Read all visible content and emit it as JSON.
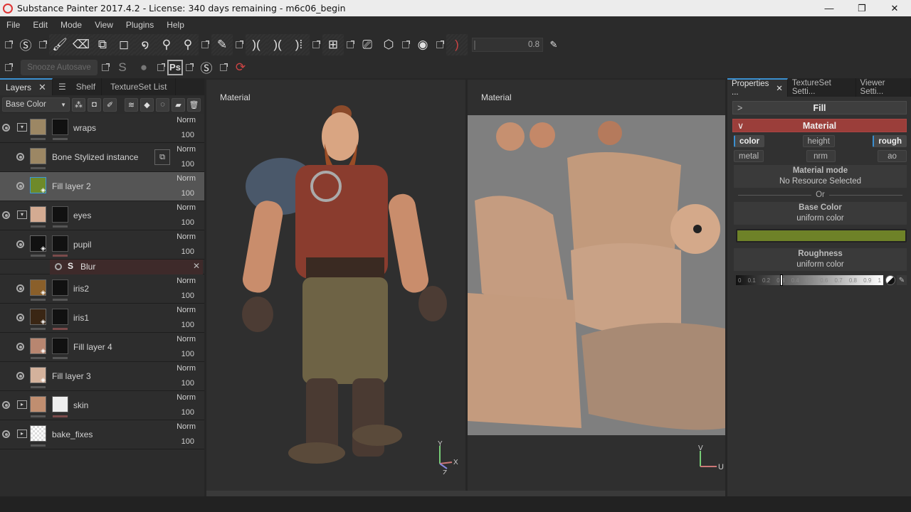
{
  "window": {
    "title": "Substance Painter 2017.4.2 - License: 340 days remaining - m6c06_begin",
    "controls": {
      "minimize": "—",
      "restore": "❐",
      "close": "✕"
    }
  },
  "menu": [
    "File",
    "Edit",
    "Mode",
    "View",
    "Plugins",
    "Help"
  ],
  "toolbar": {
    "tools": [
      "substance-logo-icon",
      "paint-brush-icon",
      "eraser-icon",
      "projection-icon",
      "polygon-fill-icon",
      "smudge-icon",
      "clone-stamp-icon",
      "material-picker-icon",
      "color-picker-icon",
      "symmetry-icon",
      "symmetry-x-icon",
      "symmetry-mirror-icon",
      "viewport-split-icon",
      "camera-icon",
      "cube-icon",
      "screenshot-icon",
      "brush-alignment-icon"
    ],
    "brush_value": "0.8",
    "snooze_label": "Snooze Autosave",
    "ps_label": "Ps"
  },
  "left_panel": {
    "tabs": [
      {
        "label": "Layers",
        "active": true
      },
      {
        "label": "Shelf",
        "active": false
      },
      {
        "label": "TextureSet List",
        "active": false
      }
    ],
    "channel": "Base Color",
    "layers": [
      {
        "name": "wraps",
        "blend": "Norm",
        "opacity": "100",
        "type": "folder",
        "thumb": "#9c8764",
        "mask": true,
        "indent": false,
        "selected": false
      },
      {
        "name": "Bone Stylized instance",
        "blend": "Norm",
        "opacity": "100",
        "type": "instance",
        "thumb": "#9c8764",
        "mask": false,
        "indent": true,
        "selected": false
      },
      {
        "name": "Fill layer 2",
        "blend": "Norm",
        "opacity": "100",
        "type": "fill",
        "thumb": "#6e8a2a",
        "mask": false,
        "indent": true,
        "selected": true
      },
      {
        "name": "eyes",
        "blend": "Norm",
        "opacity": "100",
        "type": "folder",
        "thumb": "#d4ab92",
        "mask": true,
        "indent": false,
        "selected": false
      },
      {
        "name": "pupil",
        "blend": "Norm",
        "opacity": "100",
        "type": "fill",
        "thumb": "#111111",
        "mask": true,
        "indent": true,
        "selected": false
      },
      {
        "name": "iris2",
        "blend": "Norm",
        "opacity": "100",
        "type": "fill",
        "thumb": "#8a5f2a",
        "mask": true,
        "indent": true,
        "selected": false
      },
      {
        "name": "iris1",
        "blend": "Norm",
        "opacity": "100",
        "type": "fill",
        "thumb": "#3a2614",
        "mask": true,
        "indent": true,
        "selected": false
      },
      {
        "name": "Fill layer 4",
        "blend": "Norm",
        "opacity": "100",
        "type": "fill",
        "thumb": "#b88670",
        "mask": true,
        "indent": true,
        "selected": false
      },
      {
        "name": "Fill layer 3",
        "blend": "Norm",
        "opacity": "100",
        "type": "fill",
        "thumb": "#d4b29c",
        "mask": false,
        "indent": true,
        "selected": false
      },
      {
        "name": "skin",
        "blend": "Norm",
        "opacity": "100",
        "type": "folder-closed",
        "thumb": "#c08e70",
        "mask": true,
        "indent": false,
        "selected": false
      },
      {
        "name": "bake_fixes",
        "blend": "Norm",
        "opacity": "100",
        "type": "folder-closed",
        "thumb": "checker",
        "mask": false,
        "indent": false,
        "selected": false
      }
    ],
    "effect": {
      "name": "Blur",
      "after_layer": "pupil"
    }
  },
  "viewport3d": {
    "label": "Material",
    "axes": [
      "Y",
      "X",
      "Z"
    ]
  },
  "viewport2d": {
    "label": "Material",
    "axes": [
      "V",
      "U"
    ]
  },
  "right_panel": {
    "tabs": [
      {
        "label": "Properties ...",
        "active": true
      },
      {
        "label": "TextureSet Setti...",
        "active": false
      },
      {
        "label": "Viewer Setti...",
        "active": false
      }
    ],
    "fill_label": "Fill",
    "material_label": "Material",
    "channels": [
      {
        "label": "color",
        "on": true
      },
      {
        "label": "height",
        "on": false
      },
      {
        "label": "rough",
        "on": true
      },
      {
        "label": "metal",
        "on": false
      },
      {
        "label": "nrm",
        "on": false
      },
      {
        "label": "ao",
        "on": false
      }
    ],
    "material_mode": {
      "title": "Material mode",
      "value": "No Resource Selected"
    },
    "or_label": "Or",
    "base_color": {
      "title": "Base Color",
      "mode": "uniform color",
      "color": "#6e8228"
    },
    "roughness": {
      "title": "Roughness",
      "mode": "uniform color",
      "value": 0.3,
      "ticks": [
        "0",
        "0.1",
        "0.2",
        "0.3",
        "0.4",
        "0.5",
        "0.6",
        "0.7",
        "0.8",
        "0.9",
        "1"
      ]
    }
  }
}
